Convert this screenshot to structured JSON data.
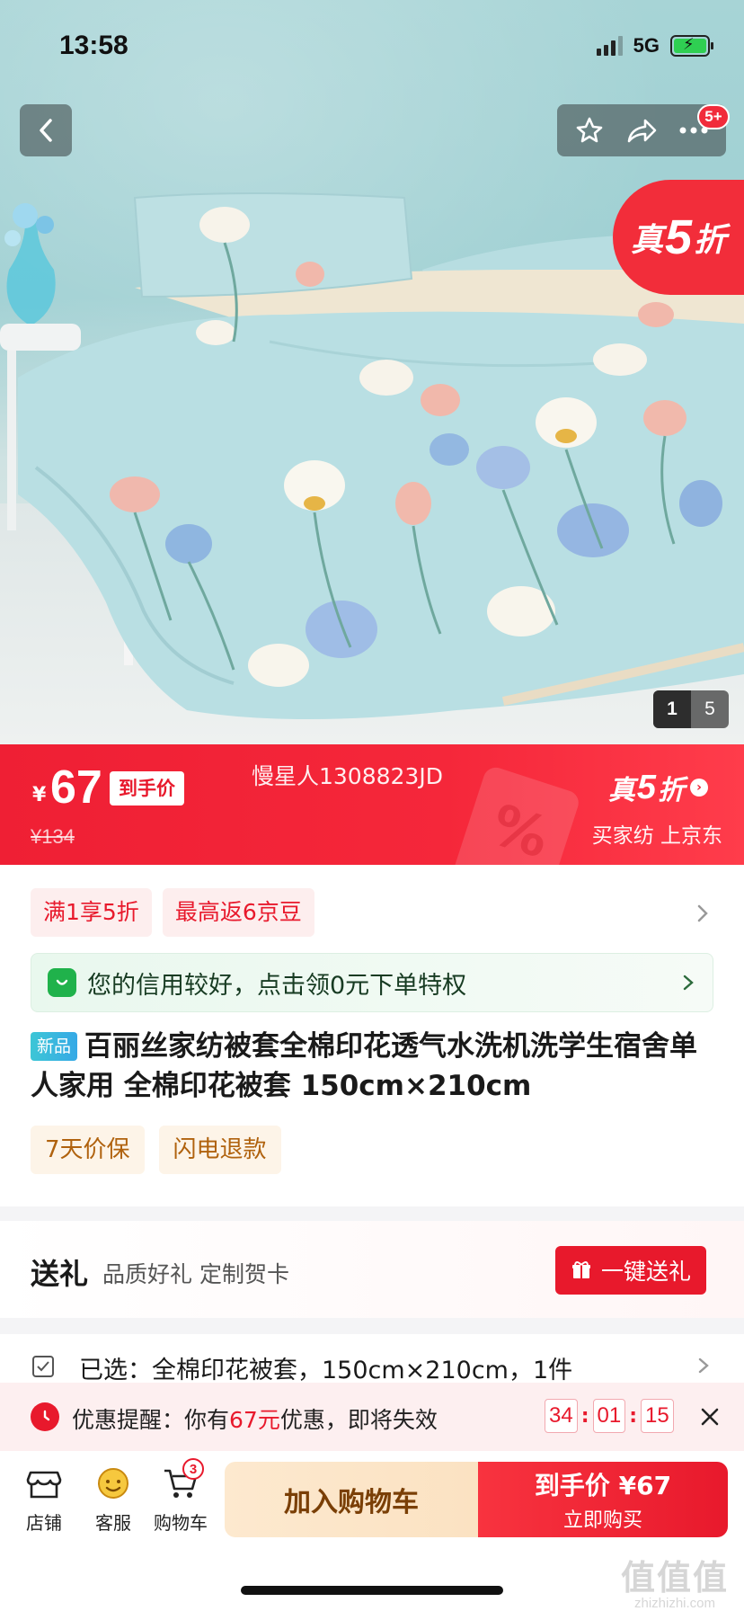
{
  "status_bar": {
    "time": "13:58",
    "network": "5G"
  },
  "header": {
    "more_badge": "5+"
  },
  "hero": {
    "sticker_prefix": "真",
    "sticker_num": "5",
    "sticker_suffix": "折",
    "page_current": "1",
    "page_total": "5",
    "colors": {
      "wall": "#a7d4d6",
      "duvet": "#b9dfe3",
      "sticker": "#f22d3a"
    }
  },
  "price_banner": {
    "currency": "¥",
    "price": "67",
    "price_tag": "到手价",
    "original_price": "¥134",
    "seller": "慢星人1308823JD",
    "promo_prefix": "真",
    "promo_num": "5",
    "promo_suffix": "折",
    "promo_sub": "买家纺 上京东"
  },
  "promo_chips": [
    "满1享5折",
    "最高返6京豆"
  ],
  "credit_strip": {
    "text": "您的信用较好，点击领0元下单特权"
  },
  "product": {
    "new_badge": "新品",
    "title": "百丽丝家纺被套全棉印花透气水洗机洗学生宿舍单人家用 全棉印花被套 150cm×210cm"
  },
  "service_tags": [
    "7天价保",
    "闪电退款"
  ],
  "gift_row": {
    "title": "送礼",
    "subtitle": "品质好礼 定制贺卡",
    "button": "一键送礼"
  },
  "selected_row": {
    "label": "已选：全棉印花被套，150cm×210cm，1件"
  },
  "reminder": {
    "prefix": "优惠提醒：你有",
    "amount": "67元",
    "suffix": "优惠，即将失效",
    "timer": [
      "34",
      "01",
      "15"
    ]
  },
  "bottom_bar": {
    "shop_label": "店铺",
    "service_label": "客服",
    "cart_label": "购物车",
    "cart_count": "3",
    "add_cart": "加入购物车",
    "buy_line1": "到手价 ¥67",
    "buy_line2": "立即购买"
  },
  "watermark": {
    "logo": "值值值",
    "url": "zhizhizhi.com"
  }
}
